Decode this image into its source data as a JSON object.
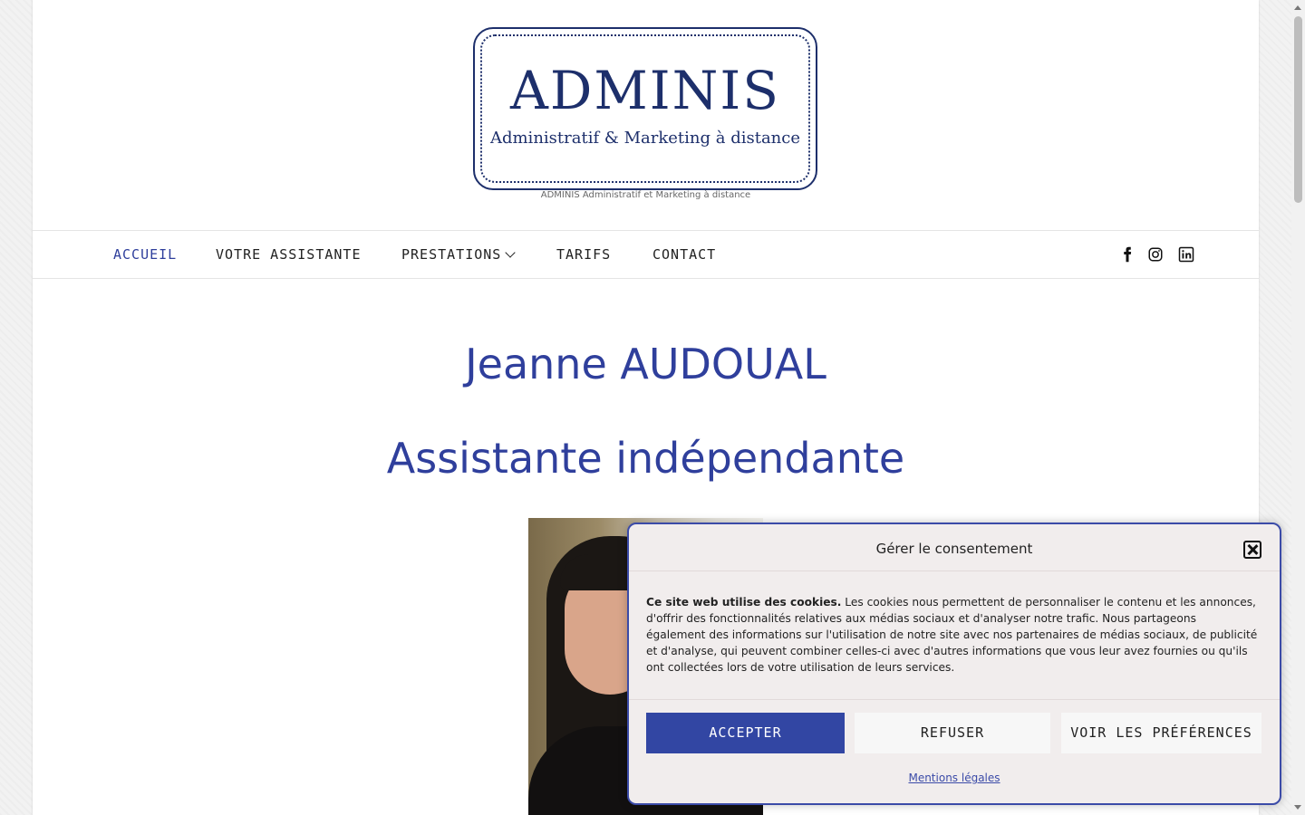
{
  "logo": {
    "title": "ADMINIS",
    "subtitle": "Administratif & Marketing à distance"
  },
  "tagline": "ADMINIS Administratif et Marketing à distance",
  "nav": {
    "items": [
      {
        "label": "ACCUEIL"
      },
      {
        "label": "VOTRE ASSISTANTE"
      },
      {
        "label": "PRESTATIONS"
      },
      {
        "label": "TARIFS"
      },
      {
        "label": "CONTACT"
      }
    ],
    "active": "ACCUEIL",
    "social": [
      "facebook-icon",
      "instagram-icon",
      "linkedin-icon"
    ]
  },
  "main": {
    "name": "Jeanne AUDOUAL",
    "role": "Assistante indépendante"
  },
  "consent": {
    "title": "Gérer le consentement",
    "text_bold": "Ce site web utilise des cookies.",
    "text": "Les cookies nous permettent de personnaliser le contenu et les annonces, d'offrir des fonctionnalités relatives aux médias sociaux et d'analyser notre trafic. Nous partageons également des informations sur l'utilisation de notre site avec nos partenaires de médias sociaux, de publicité et d'analyse, qui peuvent combiner celles-ci avec d'autres informations que vous leur avez fournies ou qu'ils ont collectées lors de votre utilisation de leurs services.",
    "accept": "ACCEPTER",
    "refuse": "REFUSER",
    "prefs": "VOIR LES PRÉFÉRENCES",
    "legal_link": "Mentions légales"
  },
  "colors": {
    "accent": "#3246a3",
    "logo": "#1d2f6b"
  }
}
